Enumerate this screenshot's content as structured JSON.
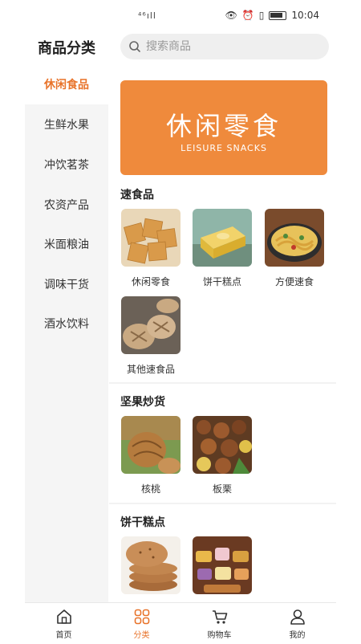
{
  "status": {
    "signal": "⁴⁶ıll",
    "time": "10:04"
  },
  "header": {
    "title": "商品分类",
    "search_placeholder": "搜索商品"
  },
  "sidebar": {
    "items": [
      {
        "label": "休闲食品",
        "active": true
      },
      {
        "label": "生鲜水果"
      },
      {
        "label": "冲饮茗茶"
      },
      {
        "label": "农资产品"
      },
      {
        "label": "米面粮油"
      },
      {
        "label": "调味干货"
      },
      {
        "label": "酒水饮料"
      }
    ]
  },
  "banner": {
    "title": "休闲零食",
    "subtitle": "LEISURE SNACKS"
  },
  "sections": [
    {
      "title": "速食品",
      "items": [
        "休闲零食",
        "饼干糕点",
        "方便速食",
        "其他速食品"
      ]
    },
    {
      "title": "坚果炒货",
      "items": [
        "核桃",
        "板栗"
      ]
    },
    {
      "title": "饼干糕点",
      "items": []
    }
  ],
  "tabbar": {
    "items": [
      {
        "label": "首页",
        "icon": "home-icon"
      },
      {
        "label": "分类",
        "icon": "category-icon",
        "active": true
      },
      {
        "label": "购物车",
        "icon": "cart-icon"
      },
      {
        "label": "我的",
        "icon": "profile-icon"
      }
    ]
  },
  "colors": {
    "accent": "#e8732a",
    "banner": "#ef8a3c",
    "sidebar_bg": "#f5f5f5"
  }
}
